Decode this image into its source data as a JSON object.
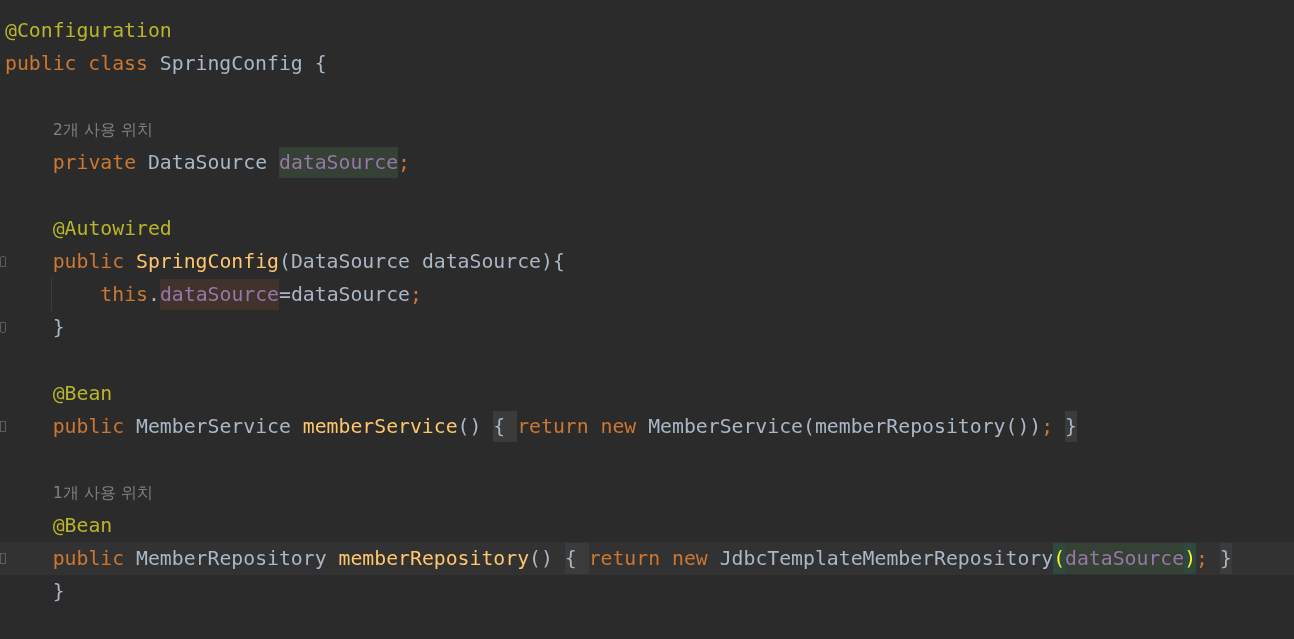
{
  "editor": {
    "lines": [
      {
        "kind": "code",
        "tokens": [
          {
            "kind": "annotation",
            "s": "@Configuration"
          }
        ]
      },
      {
        "kind": "code",
        "tokens": [
          {
            "kind": "keyword",
            "s": "public class "
          },
          {
            "kind": "plain",
            "s": "SpringConfig {"
          }
        ]
      },
      {
        "kind": "blank"
      },
      {
        "kind": "hint",
        "text": "    2개 사용 위치"
      },
      {
        "kind": "code",
        "tokens": [
          {
            "kind": "keyword",
            "s": "    private "
          },
          {
            "kind": "plain",
            "s": "DataSource "
          },
          {
            "kind": "field",
            "s": "dataSource",
            "highlight": {
              "kind": "read"
            }
          },
          {
            "kind": "punct",
            "s": ";"
          }
        ]
      },
      {
        "kind": "blank"
      },
      {
        "kind": "code",
        "tokens": [
          {
            "kind": "annotation",
            "s": "    @Autowired"
          }
        ]
      },
      {
        "kind": "code",
        "gutter": {
          "kind": "start"
        },
        "tokens": [
          {
            "kind": "keyword",
            "s": "    public "
          },
          {
            "kind": "method",
            "s": "SpringConfig"
          },
          {
            "kind": "plain",
            "s": "(DataSource dataSource){"
          }
        ]
      },
      {
        "kind": "code",
        "guide": true,
        "tokens": [
          {
            "kind": "keyword",
            "s": "        this"
          },
          {
            "kind": "plain",
            "s": "."
          },
          {
            "kind": "field",
            "s": "dataSource",
            "highlight": {
              "kind": "write"
            }
          },
          {
            "kind": "plain",
            "s": "=dataSource"
          },
          {
            "kind": "punct",
            "s": ";"
          }
        ]
      },
      {
        "kind": "code",
        "gutter": {
          "kind": "end"
        },
        "tokens": [
          {
            "kind": "plain",
            "s": "    }"
          }
        ]
      },
      {
        "kind": "blank"
      },
      {
        "kind": "code",
        "tokens": [
          {
            "kind": "annotation",
            "s": "    @Bean"
          }
        ]
      },
      {
        "kind": "code",
        "gutter": {
          "kind": "folded"
        },
        "tokens": [
          {
            "kind": "keyword",
            "s": "    public "
          },
          {
            "kind": "plain",
            "s": "MemberService "
          },
          {
            "kind": "method",
            "s": "memberService"
          },
          {
            "kind": "plain",
            "s": "() "
          },
          {
            "kind": "plain",
            "s": "{ ",
            "highlight": {
              "kind": "fold"
            }
          },
          {
            "kind": "keyword",
            "s": "return new "
          },
          {
            "kind": "plain",
            "s": "MemberService(memberRepository())"
          },
          {
            "kind": "punct",
            "s": "; "
          },
          {
            "kind": "plain",
            "s": "}",
            "highlight": {
              "kind": "fold"
            }
          }
        ]
      },
      {
        "kind": "blank"
      },
      {
        "kind": "hint",
        "text": "    1개 사용 위치"
      },
      {
        "kind": "code",
        "tokens": [
          {
            "kind": "annotation",
            "s": "    @Bean"
          }
        ]
      },
      {
        "kind": "code",
        "gutter": {
          "kind": "folded"
        },
        "current": true,
        "tokens": [
          {
            "kind": "keyword",
            "s": "    public "
          },
          {
            "kind": "plain",
            "s": "MemberRepository "
          },
          {
            "kind": "method",
            "s": "memberRepository"
          },
          {
            "kind": "plain",
            "s": "() "
          },
          {
            "kind": "plain",
            "s": "{ ",
            "highlight": {
              "kind": "fold"
            }
          },
          {
            "kind": "keyword",
            "s": "return new "
          },
          {
            "kind": "plain",
            "s": "JdbcTemplateMemberRepository"
          },
          {
            "kind": "brace",
            "s": "(",
            "highlight": {
              "kind": "match"
            }
          },
          {
            "kind": "field",
            "s": "dataSource",
            "highlight": {
              "kind": "read"
            }
          },
          {
            "kind": "brace",
            "s": ")",
            "highlight": {
              "kind": "match"
            }
          },
          {
            "kind": "punct",
            "s": "; "
          },
          {
            "kind": "plain",
            "s": "}",
            "highlight": {
              "kind": "fold"
            }
          }
        ]
      },
      {
        "kind": "code",
        "tokens": [
          {
            "kind": "plain",
            "s": "    }"
          }
        ]
      }
    ]
  }
}
